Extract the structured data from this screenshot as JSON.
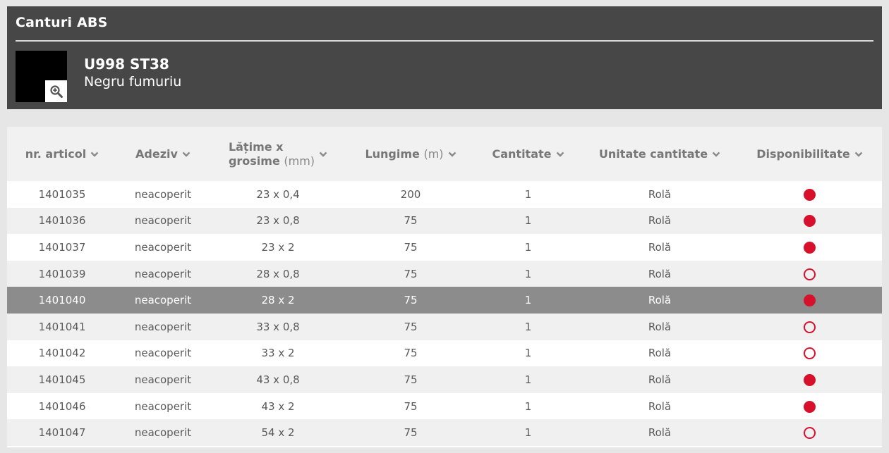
{
  "header": {
    "title": "Canturi ABS",
    "product_code": "U998 ST38",
    "product_name": "Negru fumuriu",
    "swatch_color": "#000000"
  },
  "table": {
    "columns": [
      {
        "label": "nr. articol",
        "unit": ""
      },
      {
        "label": "Adeziv",
        "unit": ""
      },
      {
        "label_line1": "Lățime x",
        "label_line2": "grosime",
        "unit": "(mm)"
      },
      {
        "label": "Lungime",
        "unit": "(m)"
      },
      {
        "label": "Cantitate",
        "unit": ""
      },
      {
        "label": "Unitate cantitate",
        "unit": ""
      },
      {
        "label": "Disponibilitate",
        "unit": ""
      }
    ],
    "rows": [
      {
        "articol": "1401035",
        "adeziv": "neacoperit",
        "dim": "23 x 0,4",
        "lungime": "200",
        "cantitate": "1",
        "unitate": "Rolă",
        "available": true
      },
      {
        "articol": "1401036",
        "adeziv": "neacoperit",
        "dim": "23 x 0,8",
        "lungime": "75",
        "cantitate": "1",
        "unitate": "Rolă",
        "available": true
      },
      {
        "articol": "1401037",
        "adeziv": "neacoperit",
        "dim": "23 x 2",
        "lungime": "75",
        "cantitate": "1",
        "unitate": "Rolă",
        "available": true
      },
      {
        "articol": "1401039",
        "adeziv": "neacoperit",
        "dim": "28 x 0,8",
        "lungime": "75",
        "cantitate": "1",
        "unitate": "Rolă",
        "available": false
      },
      {
        "articol": "1401040",
        "adeziv": "neacoperit",
        "dim": "28 x 2",
        "lungime": "75",
        "cantitate": "1",
        "unitate": "Rolă",
        "available": true,
        "selected": true
      },
      {
        "articol": "1401041",
        "adeziv": "neacoperit",
        "dim": "33 x 0,8",
        "lungime": "75",
        "cantitate": "1",
        "unitate": "Rolă",
        "available": false
      },
      {
        "articol": "1401042",
        "adeziv": "neacoperit",
        "dim": "33 x 2",
        "lungime": "75",
        "cantitate": "1",
        "unitate": "Rolă",
        "available": false
      },
      {
        "articol": "1401045",
        "adeziv": "neacoperit",
        "dim": "43 x 0,8",
        "lungime": "75",
        "cantitate": "1",
        "unitate": "Rolă",
        "available": true
      },
      {
        "articol": "1401046",
        "adeziv": "neacoperit",
        "dim": "43 x 2",
        "lungime": "75",
        "cantitate": "1",
        "unitate": "Rolă",
        "available": true
      },
      {
        "articol": "1401047",
        "adeziv": "neacoperit",
        "dim": "54 x 2",
        "lungime": "75",
        "cantitate": "1",
        "unitate": "Rolă",
        "available": false
      }
    ]
  },
  "colors": {
    "availability_red": "#d7102c",
    "header_bg": "#474747",
    "selected_row_bg": "#8c8c8c"
  },
  "icons": {
    "zoom": "zoom-in-icon",
    "sort": "chevron-down-icon",
    "available": "filled-circle",
    "unavailable": "outlined-circle"
  }
}
